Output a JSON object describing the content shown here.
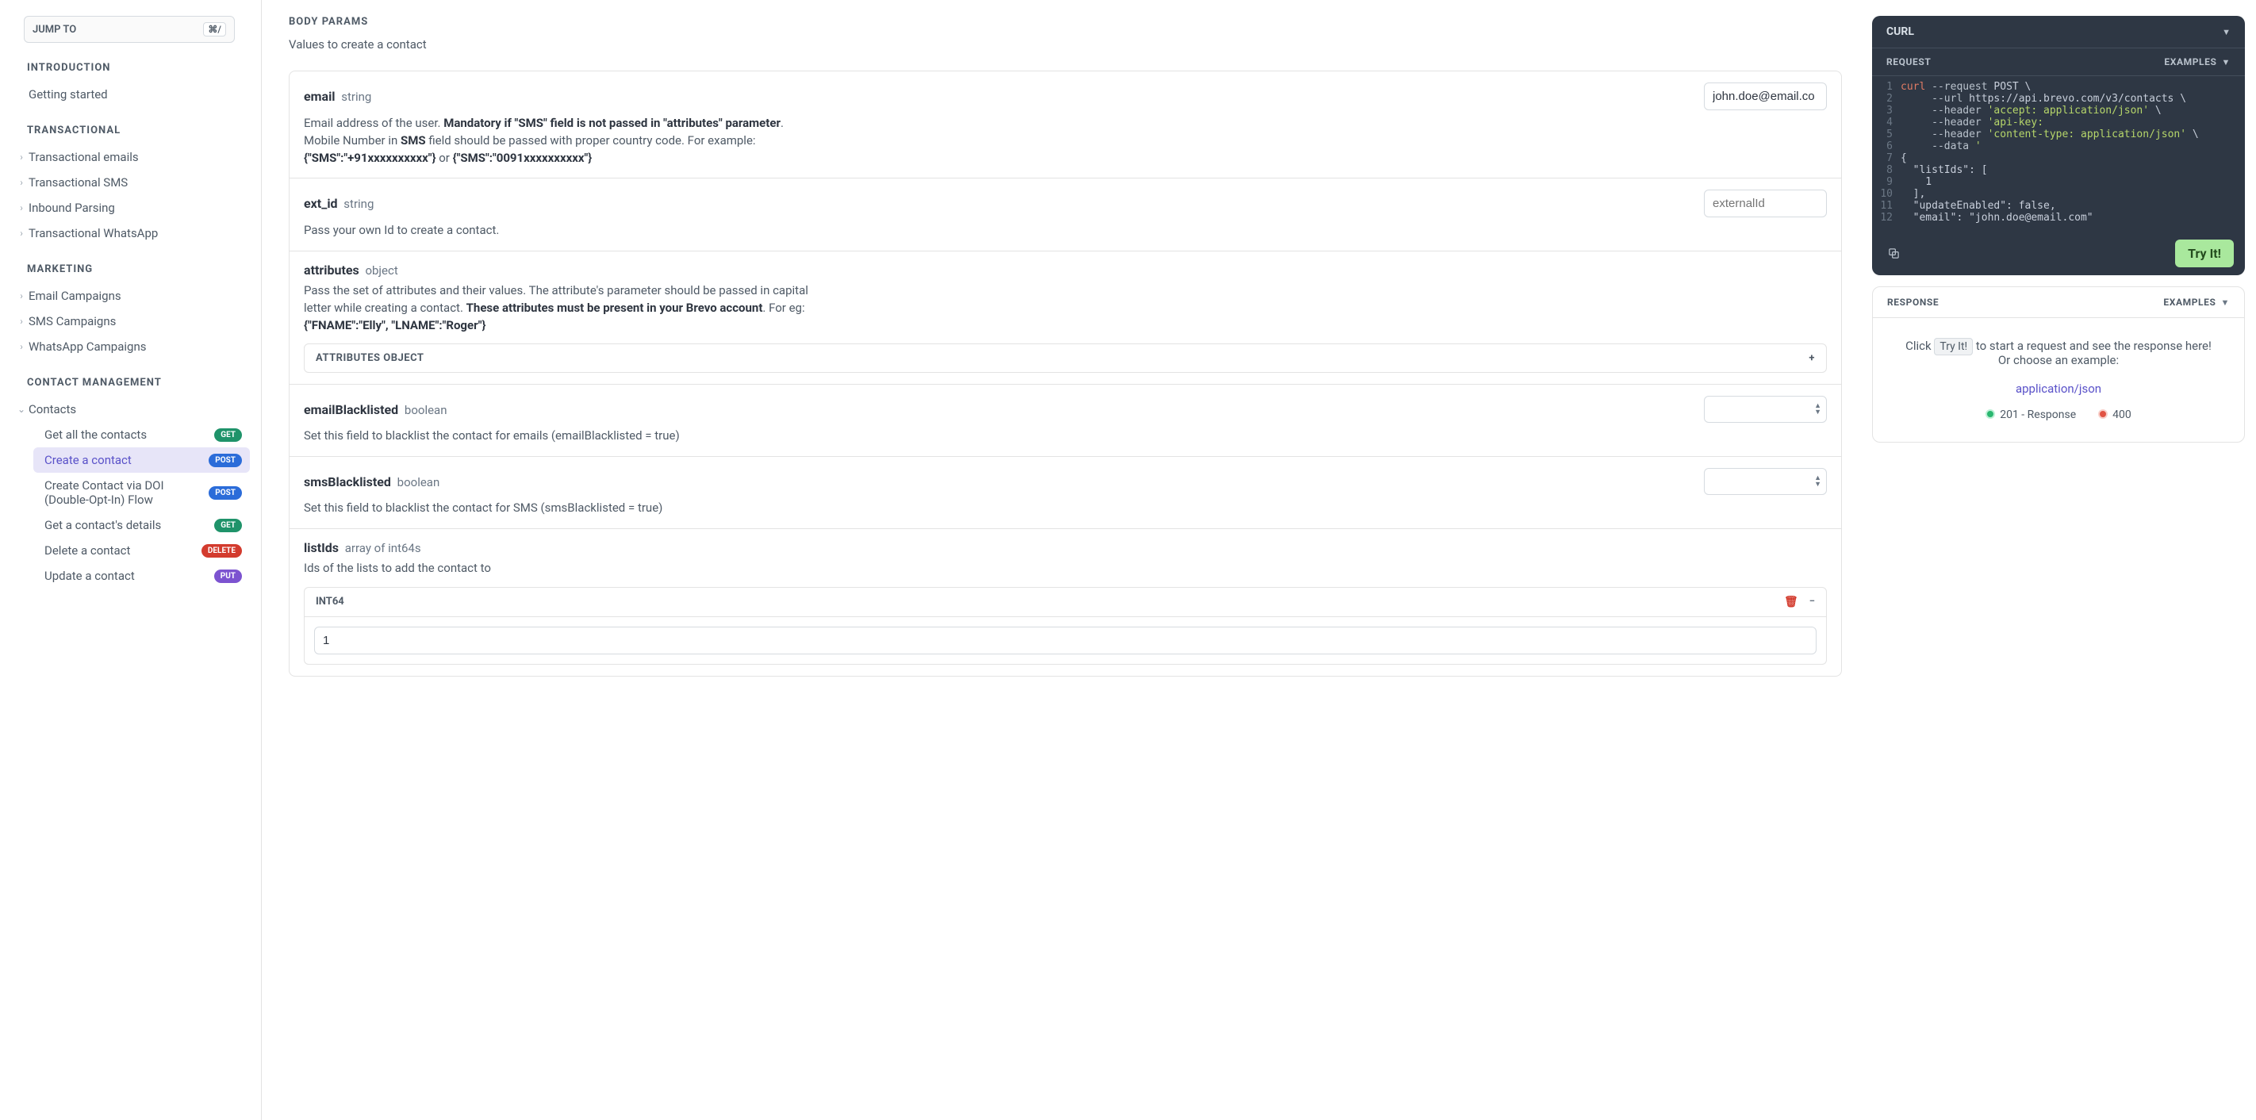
{
  "sidebar": {
    "jump": {
      "label": "JUMP TO",
      "kbd": "⌘/"
    },
    "groups": [
      {
        "head": "INTRODUCTION",
        "items": [
          {
            "label": "Getting started",
            "chevron": false
          }
        ]
      },
      {
        "head": "TRANSACTIONAL",
        "items": [
          {
            "label": "Transactional emails",
            "chevron": true
          },
          {
            "label": "Transactional SMS",
            "chevron": true
          },
          {
            "label": "Inbound Parsing",
            "chevron": true
          },
          {
            "label": "Transactional WhatsApp",
            "chevron": true
          }
        ]
      },
      {
        "head": "MARKETING",
        "items": [
          {
            "label": "Email Campaigns",
            "chevron": true
          },
          {
            "label": "SMS Campaigns",
            "chevron": true
          },
          {
            "label": "WhatsApp Campaigns",
            "chevron": true
          }
        ]
      },
      {
        "head": "CONTACT MANAGEMENT",
        "items": [
          {
            "label": "Contacts",
            "chevron": true,
            "open": true,
            "children": [
              {
                "label": "Get all the contacts",
                "badge": "GET",
                "badgeClass": "b-get"
              },
              {
                "label": "Create a contact",
                "badge": "POST",
                "badgeClass": "b-post",
                "active": true
              },
              {
                "label": "Create Contact via DOI (Double-Opt-In) Flow",
                "badge": "POST",
                "badgeClass": "b-post"
              },
              {
                "label": "Get a contact's details",
                "badge": "GET",
                "badgeClass": "b-get"
              },
              {
                "label": "Delete a contact",
                "badge": "DELETE",
                "badgeClass": "b-del"
              },
              {
                "label": "Update a contact",
                "badge": "PUT",
                "badgeClass": "b-put"
              }
            ]
          }
        ]
      }
    ]
  },
  "main": {
    "section": "BODY PARAMS",
    "subtitle": "Values to create a contact",
    "params": {
      "email": {
        "name": "email",
        "type": "string",
        "value": "john.doe@email.co",
        "desc_pre": "Email address of the user. ",
        "desc_bold1": "Mandatory if \"SMS\" field is not passed in \"attributes\" parameter",
        "desc_mid1": ". Mobile Number in ",
        "desc_bold2": "SMS",
        "desc_mid2": " field should be passed with proper country code. For example:",
        "ex1": "{\"SMS\":\"+91xxxxxxxxxx\"}",
        "or": " or ",
        "ex2": "{\"SMS\":\"0091xxxxxxxxxx\"}"
      },
      "ext_id": {
        "name": "ext_id",
        "type": "string",
        "placeholder": "externalId",
        "desc": "Pass your own Id to create a contact."
      },
      "attributes": {
        "name": "attributes",
        "type": "object",
        "desc_pre": "Pass the set of attributes and their values. The attribute's parameter should be passed in capital letter while creating a contact. ",
        "desc_bold": "These attributes must be present in your Brevo account",
        "desc_post": ". For eg:",
        "ex": "{\"FNAME\":\"Elly\", \"LNAME\":\"Roger\"}",
        "expand_label": "ATTRIBUTES OBJECT"
      },
      "emailBl": {
        "name": "emailBlacklisted",
        "type": "boolean",
        "desc": "Set this field to blacklist the contact for emails (emailBlacklisted = true)"
      },
      "smsBl": {
        "name": "smsBlacklisted",
        "type": "boolean",
        "desc": "Set this field to blacklist the contact for SMS (smsBlacklisted = true)"
      },
      "listIds": {
        "name": "listIds",
        "type": "array of int64s",
        "desc": "Ids of the lists to add the contact to",
        "int64": "INT64",
        "value": "1"
      }
    }
  },
  "right": {
    "curl": "CURL",
    "request": "REQUEST",
    "examples": "EXAMPLES",
    "code": [
      [
        {
          "c": "c-red",
          "t": "curl"
        },
        {
          "c": "c-opt",
          "t": " --request"
        },
        {
          "c": "c-pth",
          "t": " POST \\"
        }
      ],
      [
        {
          "c": "",
          "t": "     "
        },
        {
          "c": "c-opt",
          "t": "--url"
        },
        {
          "c": "c-pth",
          "t": " https://api.brevo.com/v3/contacts \\"
        }
      ],
      [
        {
          "c": "",
          "t": "     "
        },
        {
          "c": "c-opt",
          "t": "--header"
        },
        {
          "c": "c-str",
          "t": " 'accept: application/json'"
        },
        {
          "c": "c-pth",
          "t": " \\"
        }
      ],
      [
        {
          "c": "",
          "t": "     "
        },
        {
          "c": "c-opt",
          "t": "--header"
        },
        {
          "c": "c-str",
          "t": " 'api-key: "
        }
      ],
      [
        {
          "c": "",
          "t": "     "
        },
        {
          "c": "c-opt",
          "t": "--header"
        },
        {
          "c": "c-str",
          "t": " 'content-type: application/json'"
        },
        {
          "c": "c-pth",
          "t": " \\"
        }
      ],
      [
        {
          "c": "",
          "t": "     "
        },
        {
          "c": "c-opt",
          "t": "--data"
        },
        {
          "c": "c-str",
          "t": " '"
        }
      ],
      [
        {
          "c": "c-pth",
          "t": "{"
        }
      ],
      [
        {
          "c": "c-pth",
          "t": "  \"listIds\": ["
        }
      ],
      [
        {
          "c": "c-pth",
          "t": "    1"
        }
      ],
      [
        {
          "c": "c-pth",
          "t": "  ],"
        }
      ],
      [
        {
          "c": "c-pth",
          "t": "  \"updateEnabled\": false,"
        }
      ],
      [
        {
          "c": "c-pth",
          "t": "  \"email\": \"john.doe@email.com\""
        }
      ]
    ],
    "try": "Try It!",
    "response": "RESPONSE",
    "resp_click": "Click ",
    "resp_try": "Try It!",
    "resp_rest": " to start a request and see the response here!",
    "resp_or": "Or choose an example:",
    "resp_link": "application/json",
    "status201": "201 - Response",
    "status400": "400"
  }
}
